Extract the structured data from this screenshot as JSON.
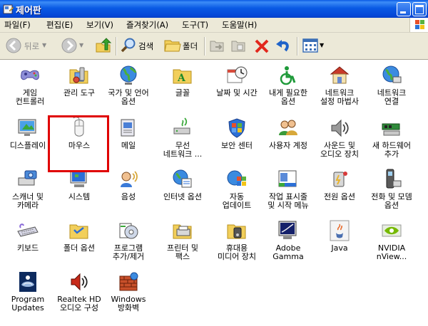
{
  "window": {
    "title": "제어판",
    "colors": {
      "titlebar": "#0a5ae4",
      "menubar": "#ece9d8",
      "highlight_box": "#e00000"
    }
  },
  "menubar": {
    "items": [
      "파일(F)",
      "편집(E)",
      "보기(V)",
      "즐겨찾기(A)",
      "도구(T)",
      "도움말(H)"
    ]
  },
  "toolbar": {
    "back_label": "뒤로",
    "search_label": "검색",
    "folders_label": "폴더"
  },
  "items": [
    {
      "label": "게임\n컨트롤러",
      "icon": "game-controller-icon"
    },
    {
      "label": "관리 도구",
      "icon": "admin-tools-icon",
      "highlighted": true
    },
    {
      "label": "국가 및 언어\n옵션",
      "icon": "globe-icon"
    },
    {
      "label": "글꼴",
      "icon": "fonts-folder-icon"
    },
    {
      "label": "날짜 및 시간",
      "icon": "calendar-clock-icon"
    },
    {
      "label": "내게 필요한\n옵션",
      "icon": "accessibility-icon"
    },
    {
      "label": "네트워크\n설정 마법사",
      "icon": "network-home-icon"
    },
    {
      "label": "네트워크\n연결",
      "icon": "network-globe-icon"
    },
    {
      "label": "디스플레이",
      "icon": "display-icon"
    },
    {
      "label": "마우스",
      "icon": "mouse-icon"
    },
    {
      "label": "메일",
      "icon": "mail-icon"
    },
    {
      "label": "무선\n네트워크 ...",
      "icon": "wireless-icon"
    },
    {
      "label": "보안 센터",
      "icon": "shield-icon"
    },
    {
      "label": "사용자 계정",
      "icon": "users-icon"
    },
    {
      "label": "사운드 및\n오디오 장치",
      "icon": "speaker-icon"
    },
    {
      "label": "새 하드웨어\n추가",
      "icon": "hardware-icon"
    },
    {
      "label": "스캐너 및\n카메라",
      "icon": "scanner-camera-icon"
    },
    {
      "label": "시스템",
      "icon": "system-icon"
    },
    {
      "label": "음성",
      "icon": "speech-icon"
    },
    {
      "label": "인터넷 옵션",
      "icon": "internet-options-icon"
    },
    {
      "label": "자동\n업데이트",
      "icon": "windows-update-icon"
    },
    {
      "label": "작업 표시줄\n및 시작 메뉴",
      "icon": "taskbar-icon"
    },
    {
      "label": "전원 옵션",
      "icon": "power-icon"
    },
    {
      "label": "전화 및 모뎀\n옵션",
      "icon": "phone-modem-icon"
    },
    {
      "label": "키보드",
      "icon": "keyboard-icon"
    },
    {
      "label": "폴더 옵션",
      "icon": "folder-options-icon"
    },
    {
      "label": "프로그램\n추가/제거",
      "icon": "add-remove-programs-icon"
    },
    {
      "label": "프린터 및\n팩스",
      "icon": "printer-icon"
    },
    {
      "label": "휴대용\n미디어 장치",
      "icon": "portable-media-icon"
    },
    {
      "label": "Adobe\nGamma",
      "icon": "adobe-gamma-icon"
    },
    {
      "label": "Java",
      "icon": "java-icon"
    },
    {
      "label": "NVIDIA\nnView...",
      "icon": "nvidia-icon"
    },
    {
      "label": "Program\nUpdates",
      "icon": "program-updates-icon"
    },
    {
      "label": "Realtek HD\n오디오 구성",
      "icon": "realtek-speaker-icon"
    },
    {
      "label": "Windows\n방화벽",
      "icon": "firewall-icon"
    }
  ]
}
